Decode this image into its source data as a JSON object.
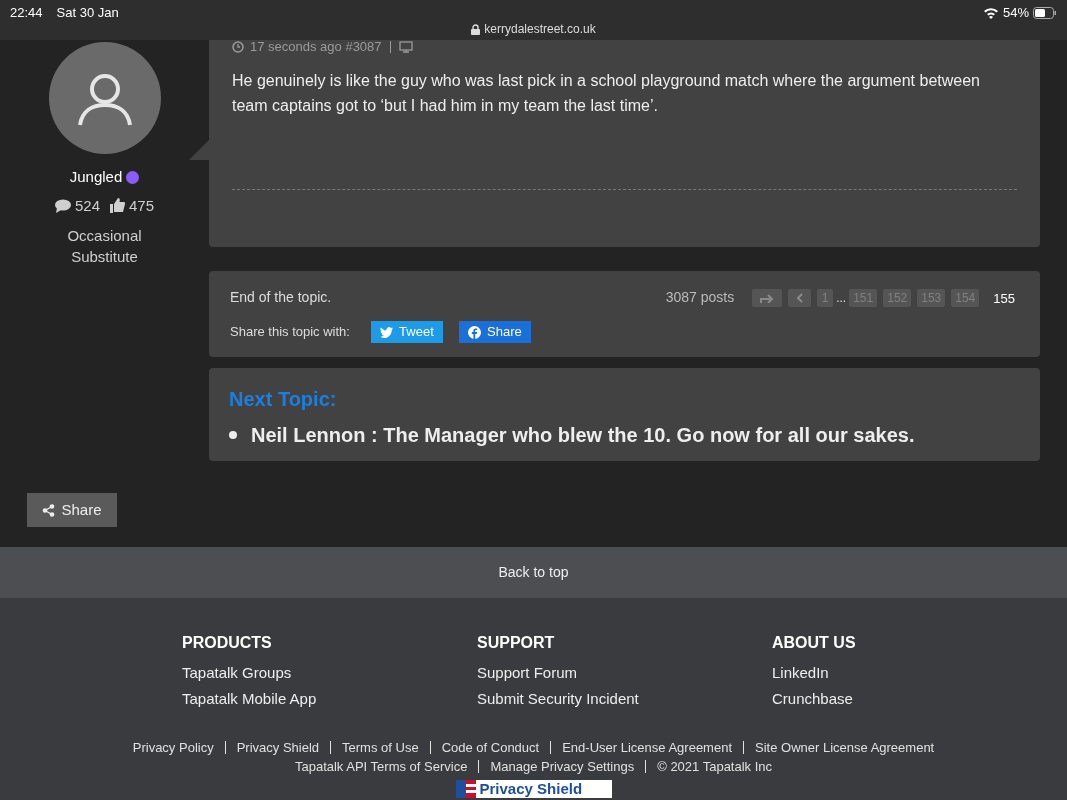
{
  "status_bar": {
    "time": "22:44",
    "date": "Sat 30 Jan",
    "url": "kerrydalestreet.co.uk",
    "battery": "54%"
  },
  "post": {
    "meta": "17 seconds ago #3087",
    "author": {
      "name": "Jungled",
      "online": true,
      "posts": "524",
      "likes": "475",
      "rank": "Occasional Substitute"
    },
    "body": "He genuinely is like the guy who was last pick in a school playground match where the argument between team captains got to ‘but I had him in my team the last time’."
  },
  "topic_end": {
    "label": "End of the topic.",
    "post_count": "3087 posts",
    "share_label": "Share this topic with:",
    "pagination": [
      {
        "kind": "jump"
      },
      {
        "kind": "prev"
      },
      {
        "kind": "page",
        "label": "1",
        "selected": false
      },
      {
        "kind": "ellipsis",
        "label": "..."
      },
      {
        "kind": "page",
        "label": "151",
        "selected": false
      },
      {
        "kind": "page",
        "label": "152",
        "selected": false
      },
      {
        "kind": "page",
        "label": "153",
        "selected": false
      },
      {
        "kind": "page",
        "label": "154",
        "selected": false
      },
      {
        "kind": "page",
        "label": "155",
        "selected": true
      }
    ],
    "share_buttons": [
      {
        "kind": "twitter",
        "label": "Tweet"
      },
      {
        "kind": "facebook",
        "label": "Share"
      }
    ]
  },
  "next_topic": {
    "heading": "Next Topic:",
    "title": "Neil Lennon : The Manager who blew the 10. Go now for all our sakes."
  },
  "share_button": "Share",
  "back_to_top": "Back to top",
  "footer": {
    "columns": [
      {
        "heading": "PRODUCTS",
        "links": [
          "Tapatalk Groups",
          "Tapatalk Mobile App"
        ]
      },
      {
        "heading": "SUPPORT",
        "links": [
          "Support Forum",
          "Submit Security Incident"
        ]
      },
      {
        "heading": "ABOUT US",
        "links": [
          "LinkedIn",
          "Crunchbase"
        ]
      }
    ],
    "legal_rows": [
      [
        "Privacy Policy",
        "Privacy Shield",
        "Terms of Use",
        "Code of Conduct",
        "End-User License Agreement",
        "Site Owner License Agreement"
      ],
      [
        "Tapatalk API Terms of Service",
        "Manage Privacy Settings",
        "© 2021 Tapatalk Inc"
      ]
    ],
    "badge": "Privacy Shield"
  }
}
